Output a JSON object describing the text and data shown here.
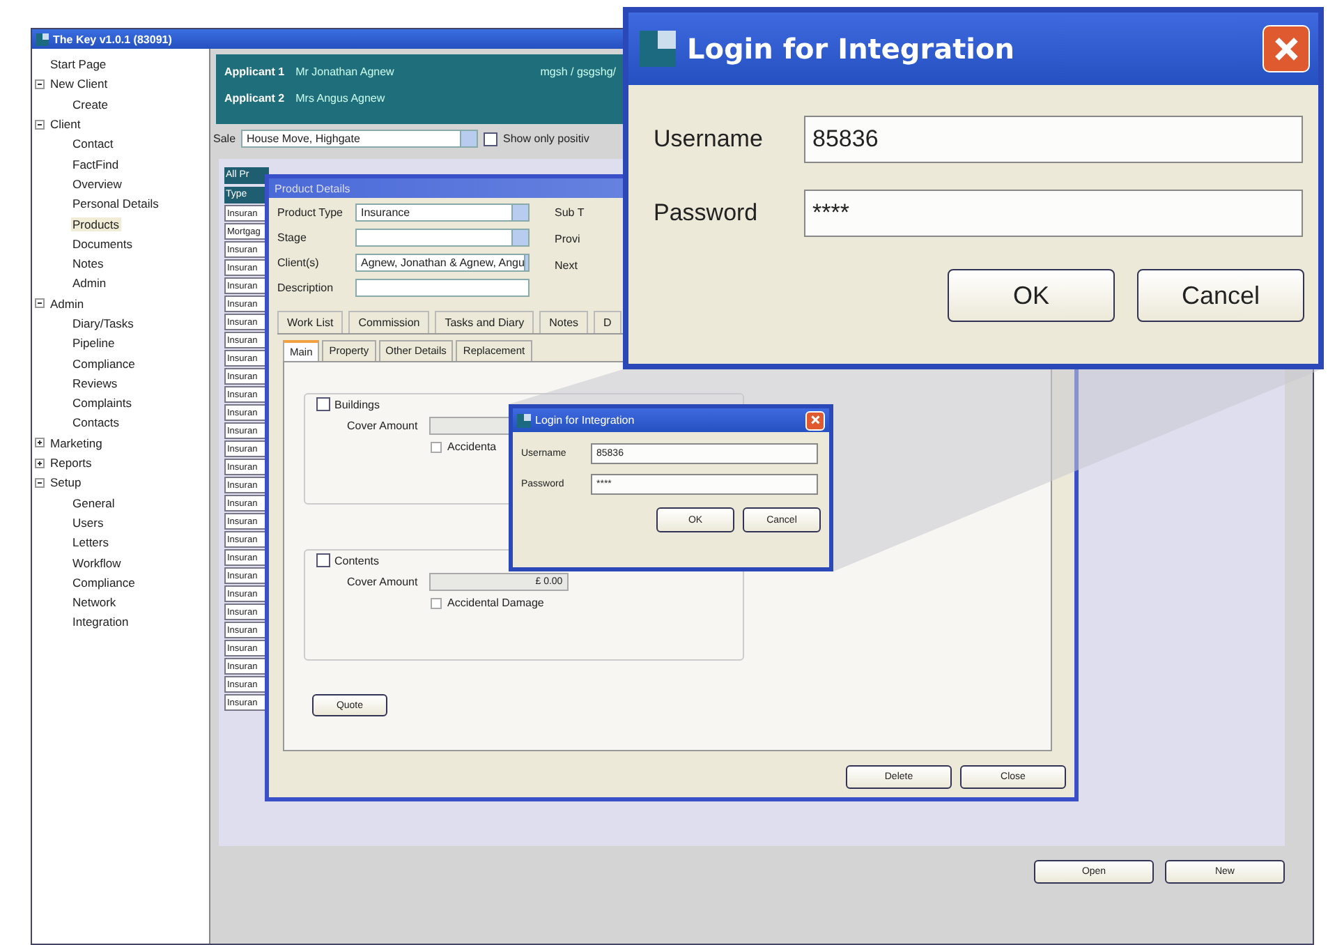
{
  "app_window": {
    "title": "The Key v1.0.1 (83091)"
  },
  "sidebar": {
    "items": [
      {
        "label": "Start Page",
        "selected": false
      },
      {
        "label": "New Client",
        "expanded": true,
        "selected": false,
        "children": [
          {
            "label": "Create",
            "selected": false
          }
        ]
      },
      {
        "label": "Client",
        "expanded": true,
        "selected": false,
        "children": [
          {
            "label": "Contact",
            "selected": false
          },
          {
            "label": "FactFind",
            "selected": false
          },
          {
            "label": "Overview",
            "selected": false
          },
          {
            "label": "Personal Details",
            "selected": false
          },
          {
            "label": "Products",
            "selected": true
          },
          {
            "label": "Documents",
            "selected": false
          },
          {
            "label": "Notes",
            "selected": false
          },
          {
            "label": "Admin",
            "selected": false
          }
        ]
      },
      {
        "label": "Admin",
        "expanded": true,
        "selected": false,
        "children": [
          {
            "label": "Diary/Tasks",
            "selected": false
          },
          {
            "label": "Pipeline",
            "selected": false
          },
          {
            "label": "Compliance",
            "selected": false
          },
          {
            "label": "Reviews",
            "selected": false
          },
          {
            "label": "Complaints",
            "selected": false
          },
          {
            "label": "Contacts",
            "selected": false
          }
        ]
      },
      {
        "label": "Marketing",
        "expanded": false,
        "selected": false
      },
      {
        "label": "Reports",
        "expanded": false,
        "selected": false
      },
      {
        "label": "Setup",
        "expanded": true,
        "selected": false,
        "children": [
          {
            "label": "General",
            "selected": false
          },
          {
            "label": "Users",
            "selected": false
          },
          {
            "label": "Letters",
            "selected": false
          },
          {
            "label": "Workflow",
            "selected": false
          },
          {
            "label": "Compliance",
            "selected": false
          },
          {
            "label": "Network",
            "selected": false
          },
          {
            "label": "Integration",
            "selected": false
          }
        ]
      }
    ]
  },
  "header": {
    "applicants": [
      {
        "label": "Applicant 1",
        "name": "Mr Jonathan Agnew"
      },
      {
        "label": "Applicant 2",
        "name": "Mrs Angus Agnew"
      }
    ],
    "reference": "mgsh / gsgshg/"
  },
  "sale": {
    "label": "Sale",
    "value": "House Move, Highgate",
    "show_only": {
      "label": "Show only positiv",
      "checked": false
    }
  },
  "product_list": {
    "headers": [
      "All Pr",
      "Type"
    ],
    "rows": [
      "Insuran",
      "Mortgag",
      "Insuran",
      "Insuran",
      "Insuran",
      "Insuran",
      "Insuran",
      "Insuran",
      "Insuran",
      "Insuran",
      "Insuran",
      "Insuran",
      "Insuran",
      "Insuran",
      "Insuran",
      "Insuran",
      "Insuran",
      "Insuran",
      "Insuran",
      "Insuran",
      "Insuran",
      "Insuran",
      "Insuran",
      "Insuran",
      "Insuran",
      "Insuran",
      "Insuran",
      "Insuran"
    ]
  },
  "product_details": {
    "title": "Product Details",
    "fields": [
      {
        "label": "Product Type",
        "value": "Insurance",
        "kind": "dropdown"
      },
      {
        "label": "Stage",
        "kind": "dropdown"
      },
      {
        "label": "Client(s)",
        "value": "Agnew, Jonathan & Agnew, Angu",
        "kind": "dropdown"
      },
      {
        "label": "Description",
        "kind": "text"
      }
    ],
    "side_labels": [
      "Sub T",
      "Provi",
      "Next"
    ],
    "tabs": [
      {
        "label": "Work List",
        "selected": false
      },
      {
        "label": "Commission",
        "selected": false
      },
      {
        "label": "Tasks and Diary",
        "selected": false
      },
      {
        "label": "Notes",
        "selected": false
      },
      {
        "label": "D",
        "selected": false
      }
    ],
    "inner_tabs": [
      {
        "label": "Main",
        "selected": true
      },
      {
        "label": "Property",
        "selected": false
      },
      {
        "label": "Other Details",
        "selected": false
      },
      {
        "label": "Replacement",
        "selected": false
      }
    ],
    "groups": [
      {
        "label": "Buildings",
        "checked": false,
        "cover_label": "Cover Amount",
        "damage_label": "Accidenta",
        "damage_checked": false
      },
      {
        "label": "Contents",
        "checked": false,
        "cover_label": "Cover Amount",
        "cover_value": "£ 0.00",
        "damage_label": "Accidental Damage",
        "damage_checked": false
      }
    ],
    "quote_button": "Quote",
    "buttons": [
      "Delete",
      "Close"
    ]
  },
  "login_dialog": {
    "title": "Login for Integration",
    "username_label": "Username",
    "username": "85836",
    "password_label": "Password",
    "password": "****",
    "buttons": [
      "OK",
      "Cancel"
    ]
  },
  "login_dialog_zoomed": {
    "title": "Login for Integration",
    "username_label": "Username",
    "username": "85836",
    "password_label": "Password",
    "password": "****",
    "buttons": [
      "OK",
      "Cancel"
    ]
  },
  "buttons": [
    "Open",
    "New"
  ]
}
